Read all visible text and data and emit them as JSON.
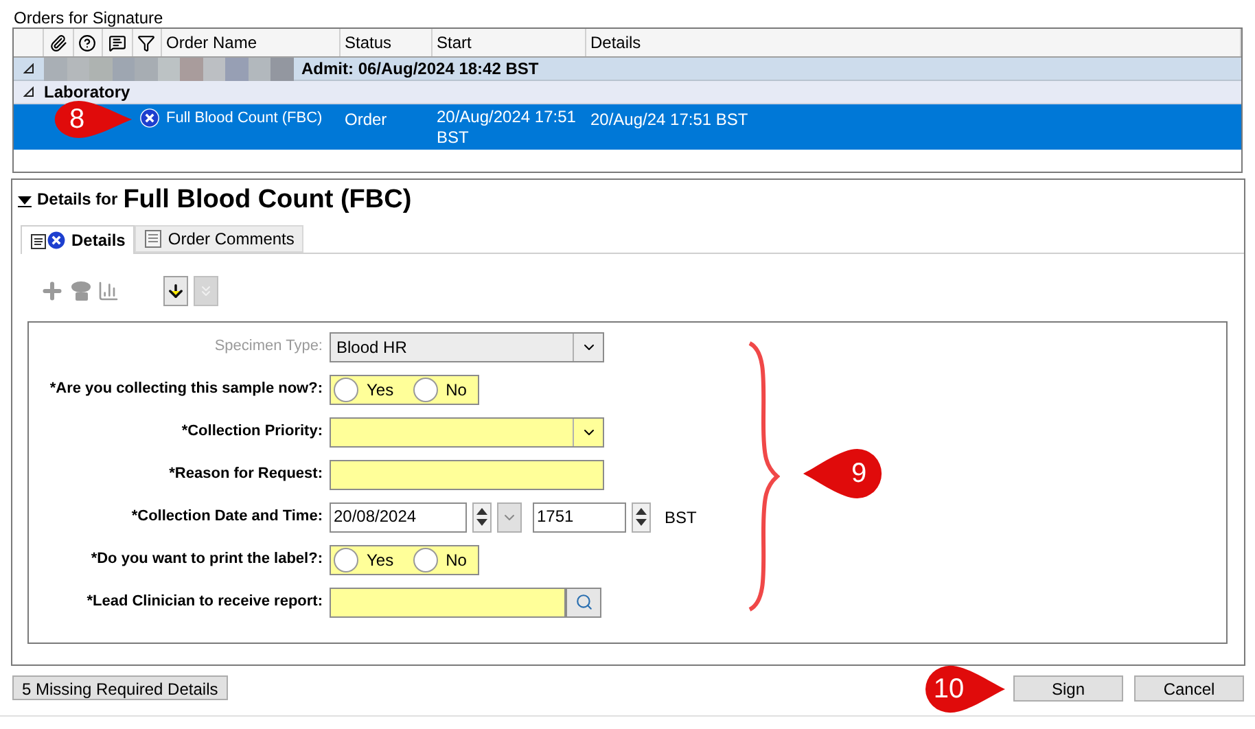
{
  "window": {
    "title": "Orders for Signature"
  },
  "orders_table": {
    "columns": [
      "Order Name",
      "Status",
      "Start",
      "Details"
    ],
    "encounter": {
      "label": "Admit: 06/Aug/2024 18:42 BST",
      "expanded": true
    },
    "groups": [
      {
        "label": "Laboratory",
        "expanded": true,
        "rows": [
          {
            "order_name": "Full Blood Count (FBC)",
            "status": "Order",
            "start": "20/Aug/2024 17:51 BST",
            "details": "20/Aug/24 17:51 BST",
            "selected": true
          }
        ]
      }
    ]
  },
  "details": {
    "prefix": "Details for",
    "title": "Full Blood Count (FBC)",
    "expanded": true,
    "tabs": [
      {
        "label": "Details",
        "selected": true
      },
      {
        "label": "Order Comments",
        "selected": false
      }
    ],
    "fields": [
      {
        "kind": "dropdown",
        "label": "Specimen Type:",
        "value": "Blood HR",
        "disabled": true,
        "highlighted": false
      },
      {
        "kind": "radio",
        "label": "*Are you collecting this sample now?:",
        "disabled": false,
        "highlighted": true,
        "options": [
          {
            "label": "Yes",
            "selected": false
          },
          {
            "label": "No",
            "selected": false
          }
        ]
      },
      {
        "kind": "dropdown",
        "label": "*Collection Priority:",
        "disabled": false,
        "highlighted": true
      },
      {
        "kind": "text",
        "label": "*Reason for Request:",
        "disabled": false,
        "highlighted": true
      },
      {
        "kind": "datetime",
        "label": "*Collection Date and Time:",
        "date": "20/08/2024",
        "time": "1751",
        "zone": "BST",
        "disabled": false,
        "highlighted": false
      },
      {
        "kind": "radio",
        "label": "*Do you want to print the label?:",
        "disabled": false,
        "highlighted": true,
        "options": [
          {
            "label": "Yes",
            "selected": false
          },
          {
            "label": "No",
            "selected": false
          }
        ]
      },
      {
        "kind": "lookup",
        "label": "*Lead Clinician to receive report:",
        "disabled": false,
        "highlighted": true
      }
    ]
  },
  "footer": {
    "missing_button": "5 Missing Required Details",
    "buttons": [
      "Sign",
      "Cancel"
    ]
  },
  "callouts": [
    "8",
    "9",
    "10"
  ]
}
